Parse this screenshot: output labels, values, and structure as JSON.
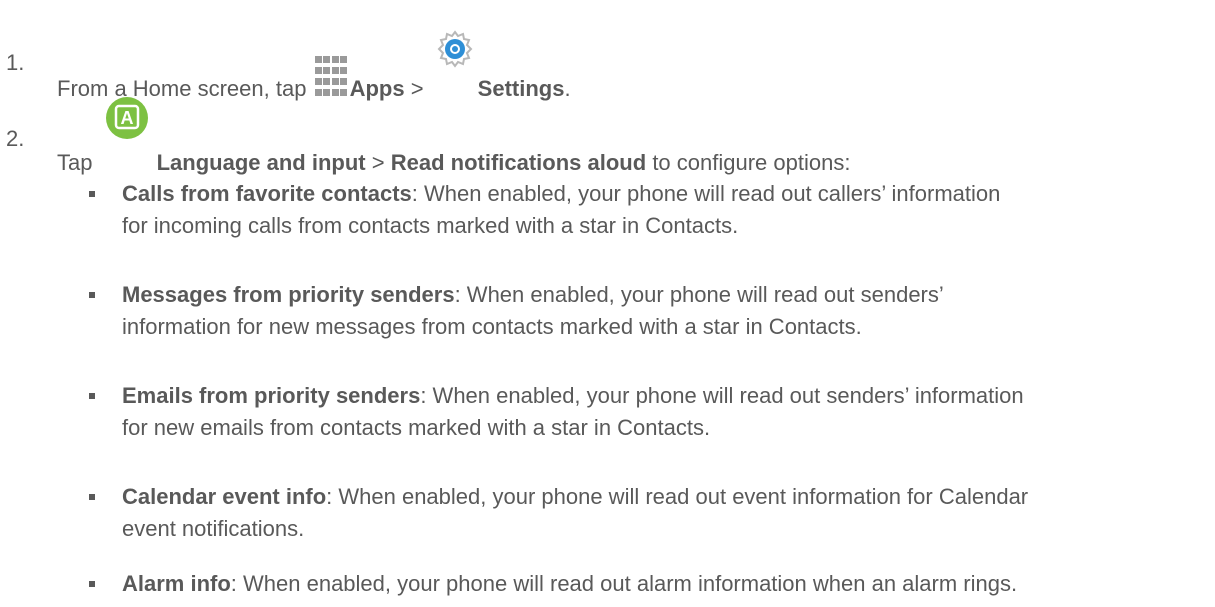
{
  "steps": [
    {
      "number": "1.",
      "prefix": "From a Home screen, tap",
      "apps_label": "Apps",
      "separator": ">",
      "settings_label": "Settings",
      "suffix": "."
    },
    {
      "number": "2.",
      "prefix": "Tap",
      "language_label": "Language and input",
      "separator": ">",
      "read_label": "Read notifications aloud",
      "suffix": "to configure options:"
    }
  ],
  "icons": {
    "apps": "apps-grid-icon",
    "settings": "gear-icon",
    "language": "language-a-icon",
    "language_letter": "A"
  },
  "options": [
    {
      "title": "Calls from favorite contacts",
      "text_line1": ": When enabled, your phone will read out callers’ information",
      "text_line2": "for incoming calls from contacts marked with a star in Contacts."
    },
    {
      "title": "Messages from priority senders",
      "text_line1": ": When enabled, your phone will read out senders’",
      "text_line2": "information for new messages from contacts marked with a star in Contacts."
    },
    {
      "title": "Emails from priority senders",
      "text_line1": ": When enabled, your phone will read out senders’ information",
      "text_line2": "for new emails from contacts marked with a star in Contacts."
    },
    {
      "title": "Calendar event info",
      "text_line1": ": When enabled, your phone will read out event information for Calendar",
      "text_line2": "event notifications."
    },
    {
      "title": "Alarm info",
      "text_line1": ": When enabled, your phone will read out alarm information when an alarm rings.",
      "text_line2": ""
    }
  ],
  "colors": {
    "text": "#595959",
    "language_icon": "#7dc142",
    "settings_icon": "#2f8fd6"
  }
}
